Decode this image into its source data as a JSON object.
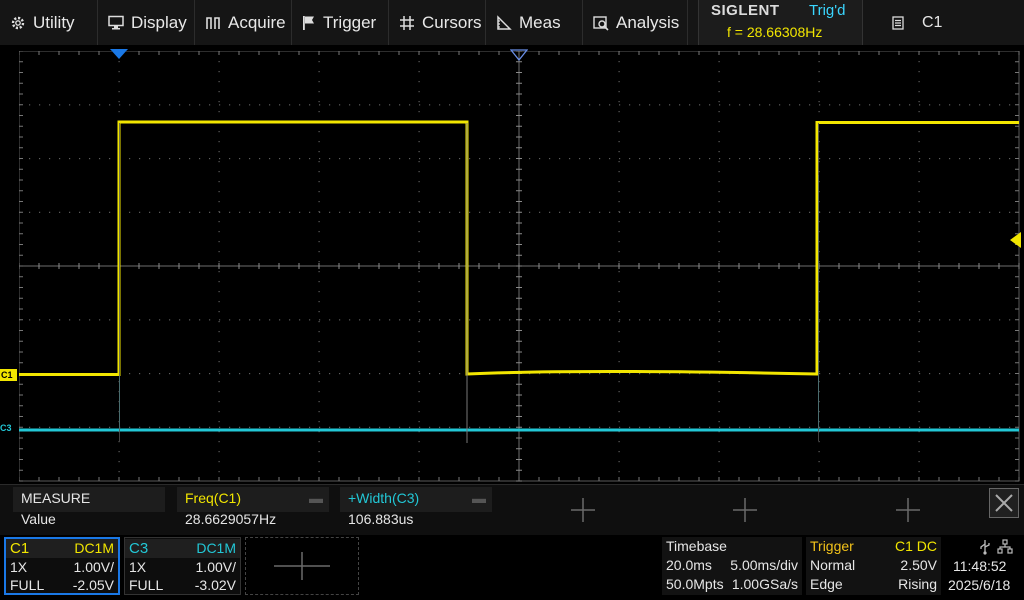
{
  "menu": [
    {
      "label": "Utility",
      "icon": "gear-icon"
    },
    {
      "label": "Display",
      "icon": "monitor-icon"
    },
    {
      "label": "Acquire",
      "icon": "acquire-icon"
    },
    {
      "label": "Trigger",
      "icon": "flag-icon"
    },
    {
      "label": "Cursors",
      "icon": "crosshair-icon"
    },
    {
      "label": "Meas",
      "icon": "ruler-icon"
    },
    {
      "label": "Analysis",
      "icon": "analysis-icon"
    }
  ],
  "brand": "SIGLENT",
  "trigger_status": "Trig'd",
  "frequency_readout": "f = 28.66308Hz",
  "channel_button": {
    "label": "C1",
    "icon": "menu-list-icon"
  },
  "markers": {
    "ch1": "C1",
    "ch3": "C3"
  },
  "measure": {
    "title": "MEASURE",
    "row_label": "Value",
    "items": [
      {
        "name": "Freq(C1)",
        "value": "28.6629057Hz"
      },
      {
        "name": "+Width(C3)",
        "value": "106.883us"
      }
    ]
  },
  "channels": [
    {
      "name": "C1",
      "coupling": "DC1M",
      "probe": "1X",
      "scale": "1.00V/",
      "bw": "FULL",
      "offset": "-2.05V"
    },
    {
      "name": "C3",
      "coupling": "DC1M",
      "probe": "1X",
      "scale": "1.00V/",
      "bw": "FULL",
      "offset": "-3.02V"
    }
  ],
  "timebase": {
    "title": "Timebase",
    "delay": "20.0ms",
    "scale": "5.00ms/div",
    "mem": "50.0Mpts",
    "rate": "1.00GSa/s"
  },
  "trigger": {
    "title": "Trigger",
    "source": "C1 DC",
    "mode": "Normal",
    "level": "2.50V",
    "type": "Edge",
    "slope": "Rising"
  },
  "clock": {
    "time": "11:48:52",
    "date": "2025/6/18"
  },
  "colors": {
    "ch1": "#f2e600",
    "ch3": "#22c7d6",
    "accent": "#3ad6ff",
    "trigger_label": "#f2c21a"
  }
}
